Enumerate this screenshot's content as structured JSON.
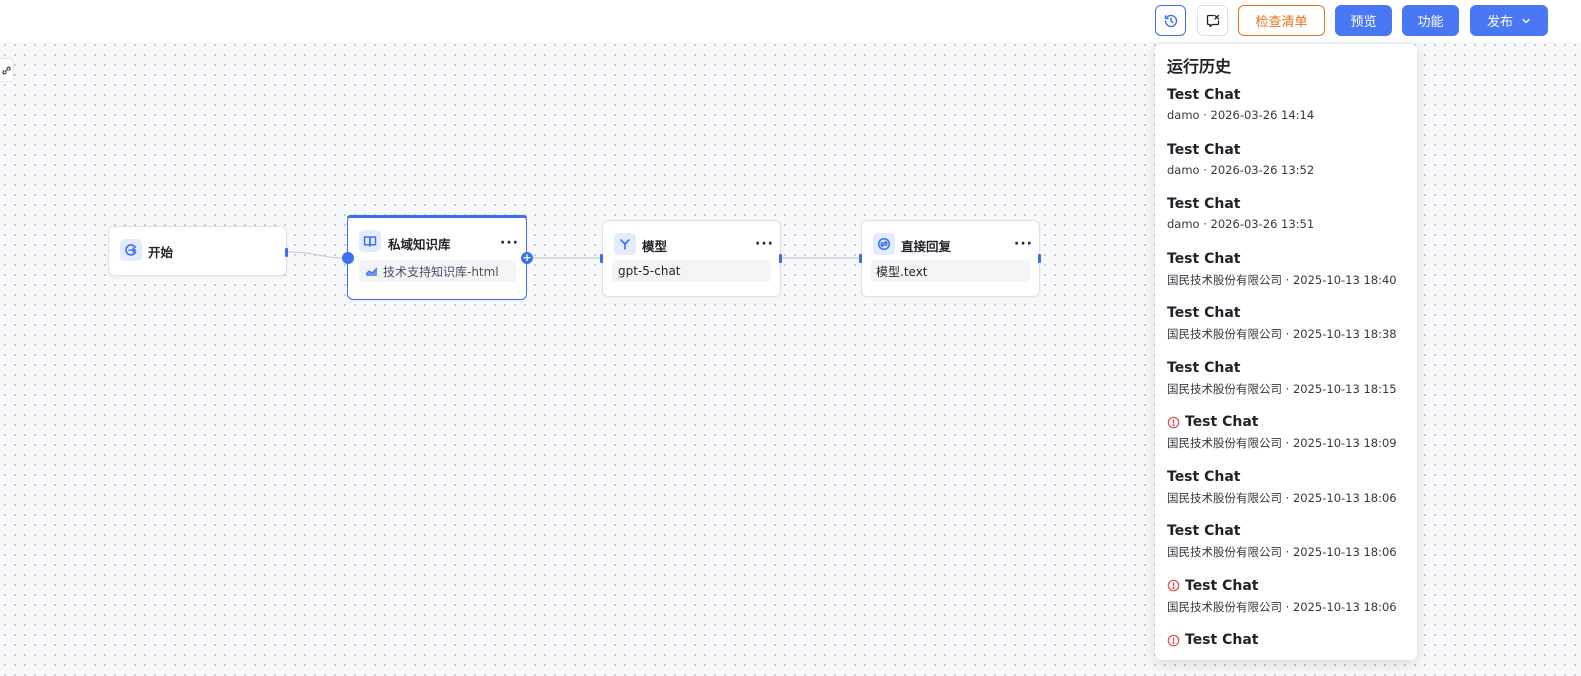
{
  "toolbar": {
    "check_list_label": "检查清单",
    "preview_label": "预览",
    "function_label": "功能",
    "publish_label": "发布"
  },
  "nodes": {
    "start": {
      "title": "开始"
    },
    "knowledge": {
      "title": "私域知识库",
      "field": "技术支持知识库-html"
    },
    "model": {
      "title": "模型",
      "field": "gpt-5-chat"
    },
    "reply": {
      "title": "直接回复",
      "field": "模型.text"
    }
  },
  "history": {
    "title": "运行历史",
    "items": [
      {
        "name": "Test Chat",
        "meta": "damo · 2026-03-26 14:14",
        "error": false
      },
      {
        "name": "Test Chat",
        "meta": "damo · 2026-03-26 13:52",
        "error": false
      },
      {
        "name": "Test Chat",
        "meta": "damo · 2026-03-26 13:51",
        "error": false
      },
      {
        "name": "Test Chat",
        "meta": "国民技术股份有限公司 · 2025-10-13 18:40",
        "error": false
      },
      {
        "name": "Test Chat",
        "meta": "国民技术股份有限公司 · 2025-10-13 18:38",
        "error": false
      },
      {
        "name": "Test Chat",
        "meta": "国民技术股份有限公司 · 2025-10-13 18:15",
        "error": false
      },
      {
        "name": "Test Chat",
        "meta": "国民技术股份有限公司 · 2025-10-13 18:09",
        "error": true
      },
      {
        "name": "Test Chat",
        "meta": "国民技术股份有限公司 · 2025-10-13 18:06",
        "error": false
      },
      {
        "name": "Test Chat",
        "meta": "国民技术股份有限公司 · 2025-10-13 18:06",
        "error": false
      },
      {
        "name": "Test Chat",
        "meta": "国民技术股份有限公司 · 2025-10-13 18:06",
        "error": true
      },
      {
        "name": "Test Chat",
        "meta": "",
        "error": true
      }
    ]
  },
  "colors": {
    "accent": "#3a6ff0",
    "button_blue": "#4a78f5",
    "check_orange": "#e8711c",
    "error_red": "#e5484d"
  },
  "icons": {
    "history": "history-icon",
    "close_chat": "chat-close-icon",
    "start": "start-icon",
    "knowledge": "book-icon",
    "model": "model-icon",
    "reply": "reply-icon",
    "error": "error-circle-icon"
  }
}
